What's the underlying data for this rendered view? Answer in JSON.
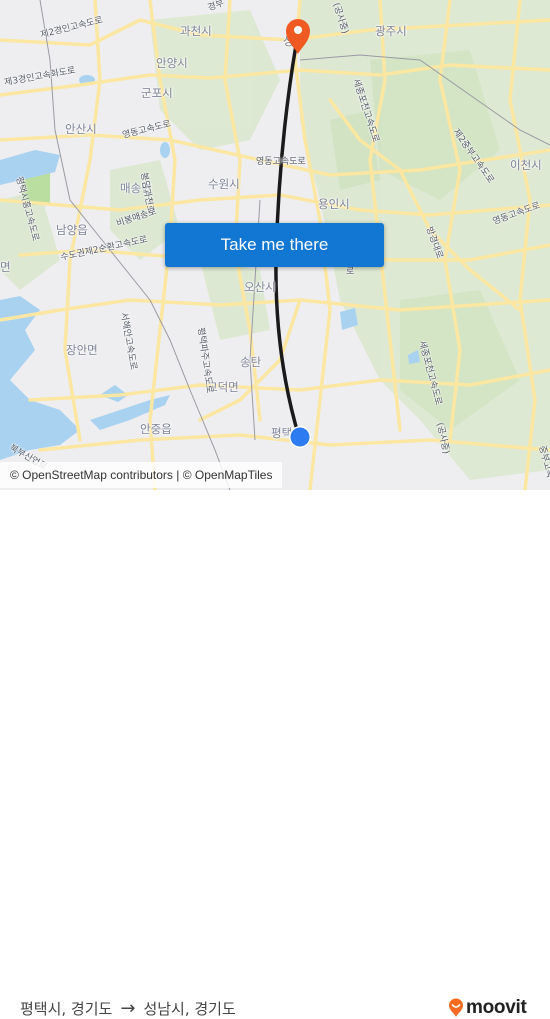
{
  "map": {
    "labels": {
      "gwacheon": "과천시",
      "anyang": "안양시",
      "gunpo": "군포시",
      "ansan": "안산시",
      "maesong": "매송면",
      "suwon": "수원시",
      "yongin": "용인시",
      "namyang": "남양읍",
      "osan": "오산시",
      "jangan": "장안면",
      "songtan": "송탄",
      "godeok": "고덕면",
      "anjung": "안중읍",
      "pyeongtaek": "평택",
      "gwangju": "광주시",
      "icheon": "이천시",
      "myeon": "면",
      "seongnam_partial": "성"
    },
    "roads": {
      "second_gyeongin": "제2경인고속도로",
      "third_gyeongin": "제3경인고속화도로",
      "yeongdong_w": "영동고속도로",
      "yeongdong_c": "영동고속도로",
      "yeongdong_e": "영동고속도로",
      "bongdam_gwacheon": "봉담과천로",
      "bibong_maesong": "비봉매송로",
      "capital_ring2": "수도권제2순환고속도로",
      "pyeongtaek_siheung": "평택시흥고속도로",
      "seohaean": "서해안고속도로",
      "pyeongtaek_paju": "평택파주고속도로",
      "sejong_pocheon_n": "세종포천고속도로",
      "sejong_pocheon_s": "세종포천고속도로",
      "construction_n": "(공사중)",
      "construction_s": "(공사중)",
      "second_jungbu": "제2중부고속도로",
      "jungbu": "중부고속",
      "bukbu": "북부산업로",
      "gyeongbu_partial": "경부",
      "bangyeong": "방경대로",
      "ro_partial": "로"
    },
    "origin_marker": {
      "name": "평택",
      "color": "#2d7bf0"
    },
    "destination_marker": {
      "name": "성남",
      "color": "#f05a22"
    },
    "route_color": "#1a1a1a",
    "attribution": "© OpenStreetMap contributors | © OpenMapTiles"
  },
  "cta": {
    "label": "Take me there",
    "color": "#1276d3"
  },
  "footer": {
    "origin": "평택시, 경기도",
    "arrow": "→",
    "destination": "성남시, 경기도",
    "brand": "moovit",
    "brand_color": "#f26b21"
  }
}
